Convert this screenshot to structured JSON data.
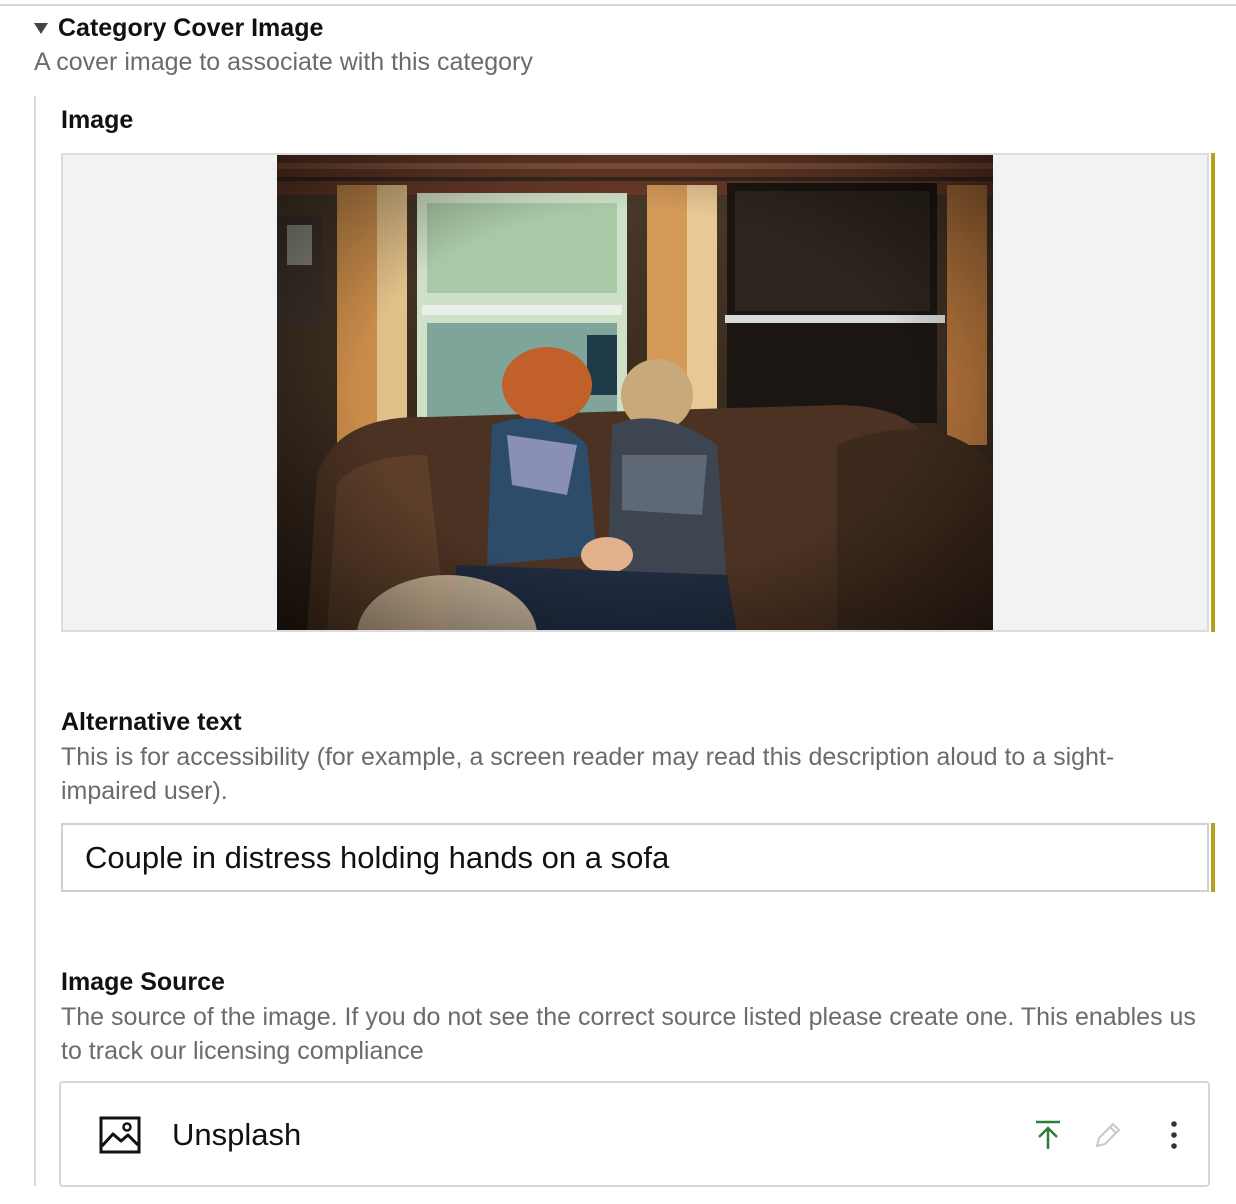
{
  "section": {
    "title": "Category Cover Image",
    "description": "A cover image to associate with this category"
  },
  "image_field": {
    "label": "Image",
    "preview_icon": "photo-preview"
  },
  "alt_text_field": {
    "label": "Alternative text",
    "description": "This is for accessibility (for example, a screen reader may read this description aloud to a sight-impaired user).",
    "value": "Couple in distress holding hands on a sofa"
  },
  "image_source_field": {
    "label": "Image Source",
    "description": "The source of the image. If you do not see the correct source listed please create one. This enables us to track our licensing compliance",
    "selected": {
      "name": "Unsplash",
      "icon": "image-icon"
    },
    "actions": [
      "upload-icon",
      "pencil-icon",
      "more-vertical-icon"
    ]
  },
  "colors": {
    "accent": "#b8a11a",
    "upload_icon": "#2e7d32",
    "muted_text": "#6b6b6b"
  }
}
